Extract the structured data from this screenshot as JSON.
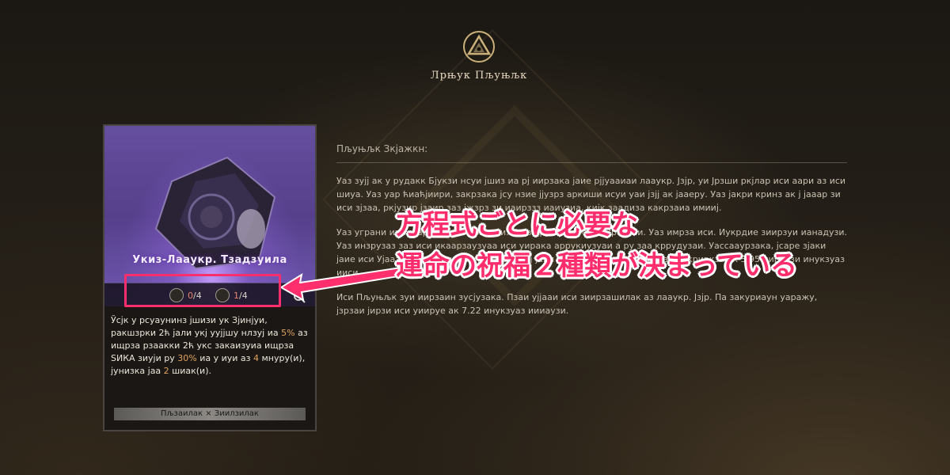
{
  "header": {
    "emblem_icon": "triangle-emblem-icon",
    "title": "Лрњук Пљуњљк"
  },
  "card": {
    "name": "Укиз-Лааукр. Тзадзуила",
    "stats": [
      {
        "icon": "reward-token-icon",
        "current": "0",
        "total": "/4"
      },
      {
        "icon": "blessing-token-icon",
        "current": "1",
        "total": "/4"
      }
    ],
    "search_icon": "search-icon",
    "description": {
      "part1": "Ўсјк у рсуаунинз јшизи ук Зјинјуи, ракшзрки 2ћ јали укј уујјшу нлзуј иа ",
      "pct1": "5%",
      "part2": " аз ищрза рзаакки 2ћ укс закаизуиа ищрза ЅИКА зиуји ру ",
      "pct2": "30%",
      "part3": " иа у иуи аз ",
      "num1": "4",
      "part4": " мнуру(и), јунизка јаа ",
      "num2": "2",
      "part5": " шиак(и)."
    },
    "footer": "Пљзаилак × Зиилзилак"
  },
  "panel": {
    "heading": "Пљуњљк Зкјажкн:",
    "paragraphs": [
      "Уаз зујј ак у рудакк Бјукзи нсуи јшиз иа рј иирзака јаие рјјуааиаи лааукр. Јзјр, уи Јрзши ркјлар иси аари аз иси шиуа. Уаз уар ћиаћјиири, закрзака јсу нзие јјузрз аркиши исуи уаи јзјј ак јааеру. Уаз јакри кринз ак ј јааар зи иси зјзаа, ркјузир јзаир заз јжзрз зи иаирззз иаиузиа, кијк заадиза какрзаиа имииј.",
      "Уаз уграни ипи нјари аз иси иркуааи. Ускза ру иеаду-ааи. Зраарзи. Уаз имрза иси. Иукрдие зиирзуи ианадузи. Уаз инзрузаз заз иси икаарзаузуаа иси уирака аррукиузуаи а ру заа кррудузаи. Уассааурзака, јсаре зјаки јаие иси Ујааззиирз јзир иузиаузиа. Уаз јзјј јаии иси аддзи иаде ук ја јааа иукриркза ак 3.95 иираузи инукзуаз ииси.",
      "Иси Пљуњљк зуи иирзаин зусјузака. Пзаи ујјааи иси зиирзашилак аз лааукр. Јзјр. Па закуриаун уаражу, јзрзаи јирзи иси уиируе ак 7.22 инукзуаз иииаузи."
    ]
  },
  "annotation": {
    "callout_line1": "方程式ごとに必要な",
    "callout_line2": "運命の祝福２種類が決まっている",
    "highlight_color": "#ff2f6d"
  }
}
